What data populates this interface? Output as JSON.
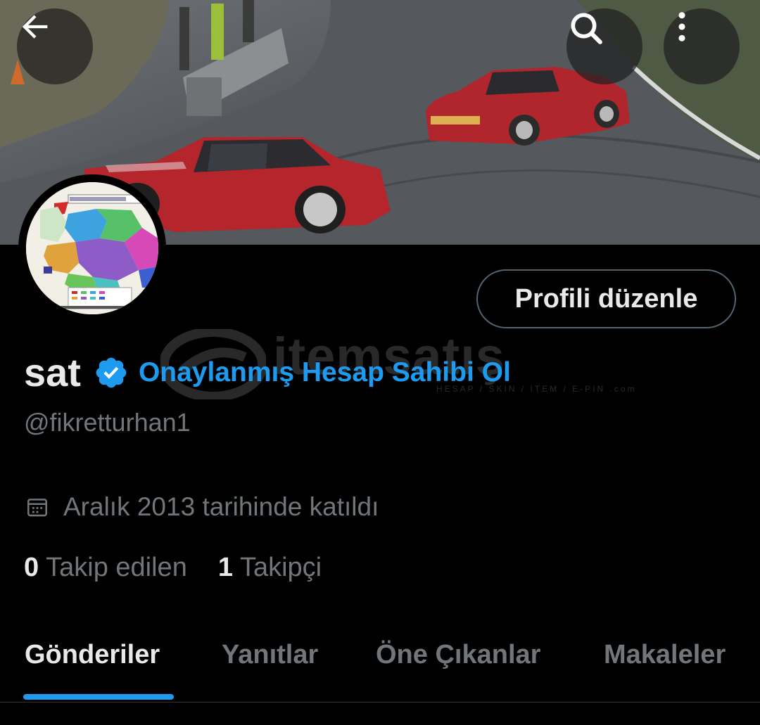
{
  "profile": {
    "name": "sat",
    "verify_link": "Onaylanmış Hesap Sahibi Ol",
    "handle": "@fikretturhan1",
    "joined": "Aralık 2013 tarihinde katıldı",
    "following_count": "0",
    "following_label": "Takip edilen",
    "followers_count": "1",
    "followers_label": "Takipçi",
    "edit_button": "Profili düzenle"
  },
  "watermark": {
    "text": "itemsatış",
    "sub": "HESAP / SKIN / ITEM / E-PIN .com"
  },
  "tabs": [
    {
      "label": "Gönderiler",
      "active": true
    },
    {
      "label": "Yanıtlar",
      "active": false
    },
    {
      "label": "Öne Çıkanlar",
      "active": false
    },
    {
      "label": "Makaleler",
      "active": false
    }
  ],
  "colors": {
    "accent": "#1d9bf0",
    "background": "#000000",
    "text_primary": "#e7e9ea",
    "text_secondary": "#71767b",
    "border": "#536471"
  },
  "icons": {
    "back": "arrow-left-icon",
    "search": "search-icon",
    "more": "more-vertical-icon",
    "verified": "verified-badge-icon",
    "calendar": "calendar-icon"
  }
}
